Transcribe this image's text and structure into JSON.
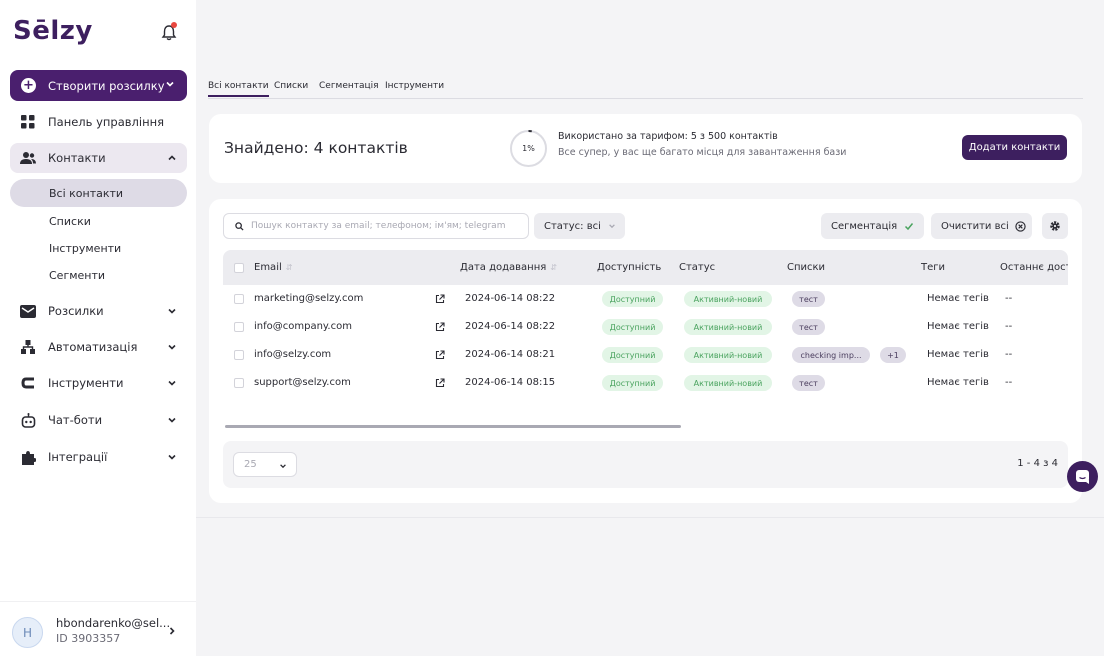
{
  "brand": {
    "logo": "Sēlzy",
    "accent": "#4a1f6e"
  },
  "sidebar": {
    "create_label": "Створити розсилку",
    "items": [
      {
        "label": "Панель управління",
        "icon": "dashboard-icon"
      },
      {
        "label": "Контакти",
        "icon": "contacts-icon"
      },
      {
        "label": "Розсилки",
        "icon": "mail-icon"
      },
      {
        "label": "Автоматизація",
        "icon": "automation-icon"
      },
      {
        "label": "Інструменти",
        "icon": "tools-icon"
      },
      {
        "label": "Чат-боти",
        "icon": "chatbot-icon"
      },
      {
        "label": "Інтеграції",
        "icon": "puzzle-icon"
      }
    ],
    "contacts_sub": [
      "Всі контакти",
      "Списки",
      "Інструменти",
      "Сегменти"
    ]
  },
  "user": {
    "initial": "H",
    "name": "hbondarenko@sel...",
    "id": "ID 3903357"
  },
  "tabs": [
    "Всі контакти",
    "Списки",
    "Сегментація",
    "Інструменти"
  ],
  "summary": {
    "found": "Знайдено: 4 контактів",
    "percent": "1%",
    "percent_value": 1,
    "usage_line1": "Використано за тарифом: 5 з 500 контактів",
    "usage_line2": "Все супер, у вас ще багато місця для завантаження бази",
    "add_button": "Додати контакти"
  },
  "filters": {
    "search_placeholder": "Пошук контакту за email; телефоном; ім'ям; telegram",
    "status": "Статус: всі",
    "segmentation": "Сегментація",
    "clear_all": "Очистити всі"
  },
  "table": {
    "headers": [
      "Email",
      "Дата додавання",
      "Доступність",
      "Статус",
      "Списки",
      "Теги",
      "Останнє дост"
    ],
    "rows": [
      {
        "email": "marketing@selzy.com",
        "date": "2024-06-14 08:22",
        "availability": "Доступний",
        "status": "Активний-новий",
        "list": "тест",
        "extra": "",
        "tags": "Немає тегів",
        "last": "--"
      },
      {
        "email": "info@company.com",
        "date": "2024-06-14 08:22",
        "availability": "Доступний",
        "status": "Активний-новий",
        "list": "тест",
        "extra": "",
        "tags": "Немає тегів",
        "last": "--"
      },
      {
        "email": "info@selzy.com",
        "date": "2024-06-14 08:21",
        "availability": "Доступний",
        "status": "Активний-новий",
        "list": "checking imp...",
        "extra": "+1",
        "tags": "Немає тегів",
        "last": "--"
      },
      {
        "email": "support@selzy.com",
        "date": "2024-06-14 08:15",
        "availability": "Доступний",
        "status": "Активний-новий",
        "list": "тест",
        "extra": "",
        "tags": "Немає тегів",
        "last": "--"
      }
    ]
  },
  "footer": {
    "per_page": "25",
    "pager": "1 - 4 з 4"
  }
}
